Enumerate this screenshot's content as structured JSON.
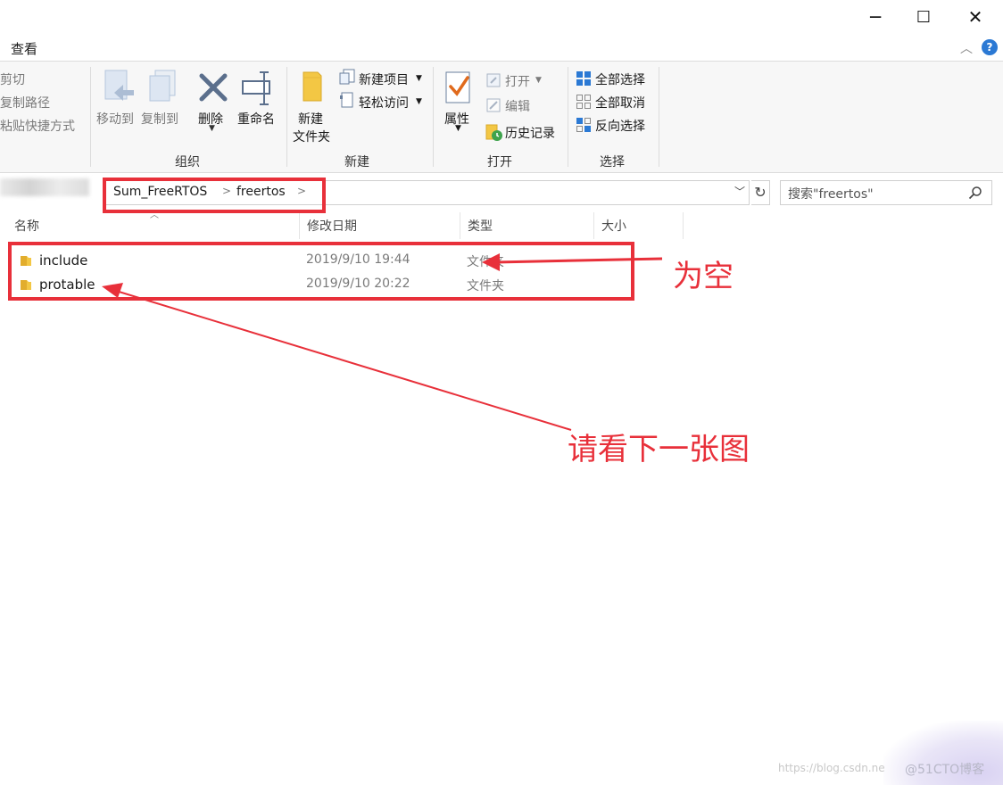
{
  "window": {
    "controls": {
      "minimize": "─",
      "maximize": "☐",
      "close": "✕"
    }
  },
  "ribbon": {
    "active_tab": "查看",
    "help": "?",
    "clipboard": {
      "cut": "剪切",
      "copy_path": "复制路径",
      "paste_shortcut": "粘贴快捷方式"
    },
    "organize": {
      "title": "组织",
      "move_to": "移动到",
      "copy_to": "复制到",
      "delete": "删除",
      "rename": "重命名"
    },
    "new": {
      "title": "新建",
      "new_folder_line1": "新建",
      "new_folder_line2": "文件夹",
      "new_item": "新建项目",
      "easy_access": "轻松访问"
    },
    "open": {
      "title": "打开",
      "properties": "属性",
      "open": "打开",
      "edit": "编辑",
      "history": "历史记录"
    },
    "select": {
      "title": "选择",
      "select_all": "全部选择",
      "select_none": "全部取消",
      "invert": "反向选择"
    }
  },
  "address": {
    "crumbs": [
      "Sum_FreeRTOS",
      "freertos"
    ],
    "separator": ">",
    "search_placeholder": "搜索\"freertos\""
  },
  "columns": {
    "name": "名称",
    "modified": "修改日期",
    "type": "类型",
    "size": "大小"
  },
  "files": [
    {
      "name": "include",
      "modified": "2019/9/10 19:44",
      "type": "文件夹"
    },
    {
      "name": "protable",
      "modified": "2019/9/10 20:22",
      "type": "文件夹"
    }
  ],
  "annotations": {
    "empty_note": "为空",
    "see_next": "请看下一张图"
  },
  "watermark": {
    "url": "https://blog.csdn.ne",
    "site": "@51CTO博客"
  },
  "colors": {
    "annotation_red": "#e8303a",
    "folder_yellow": "#f3c744",
    "ribbon_bg": "#f7f7f7",
    "select_blue": "#2b79d4"
  }
}
